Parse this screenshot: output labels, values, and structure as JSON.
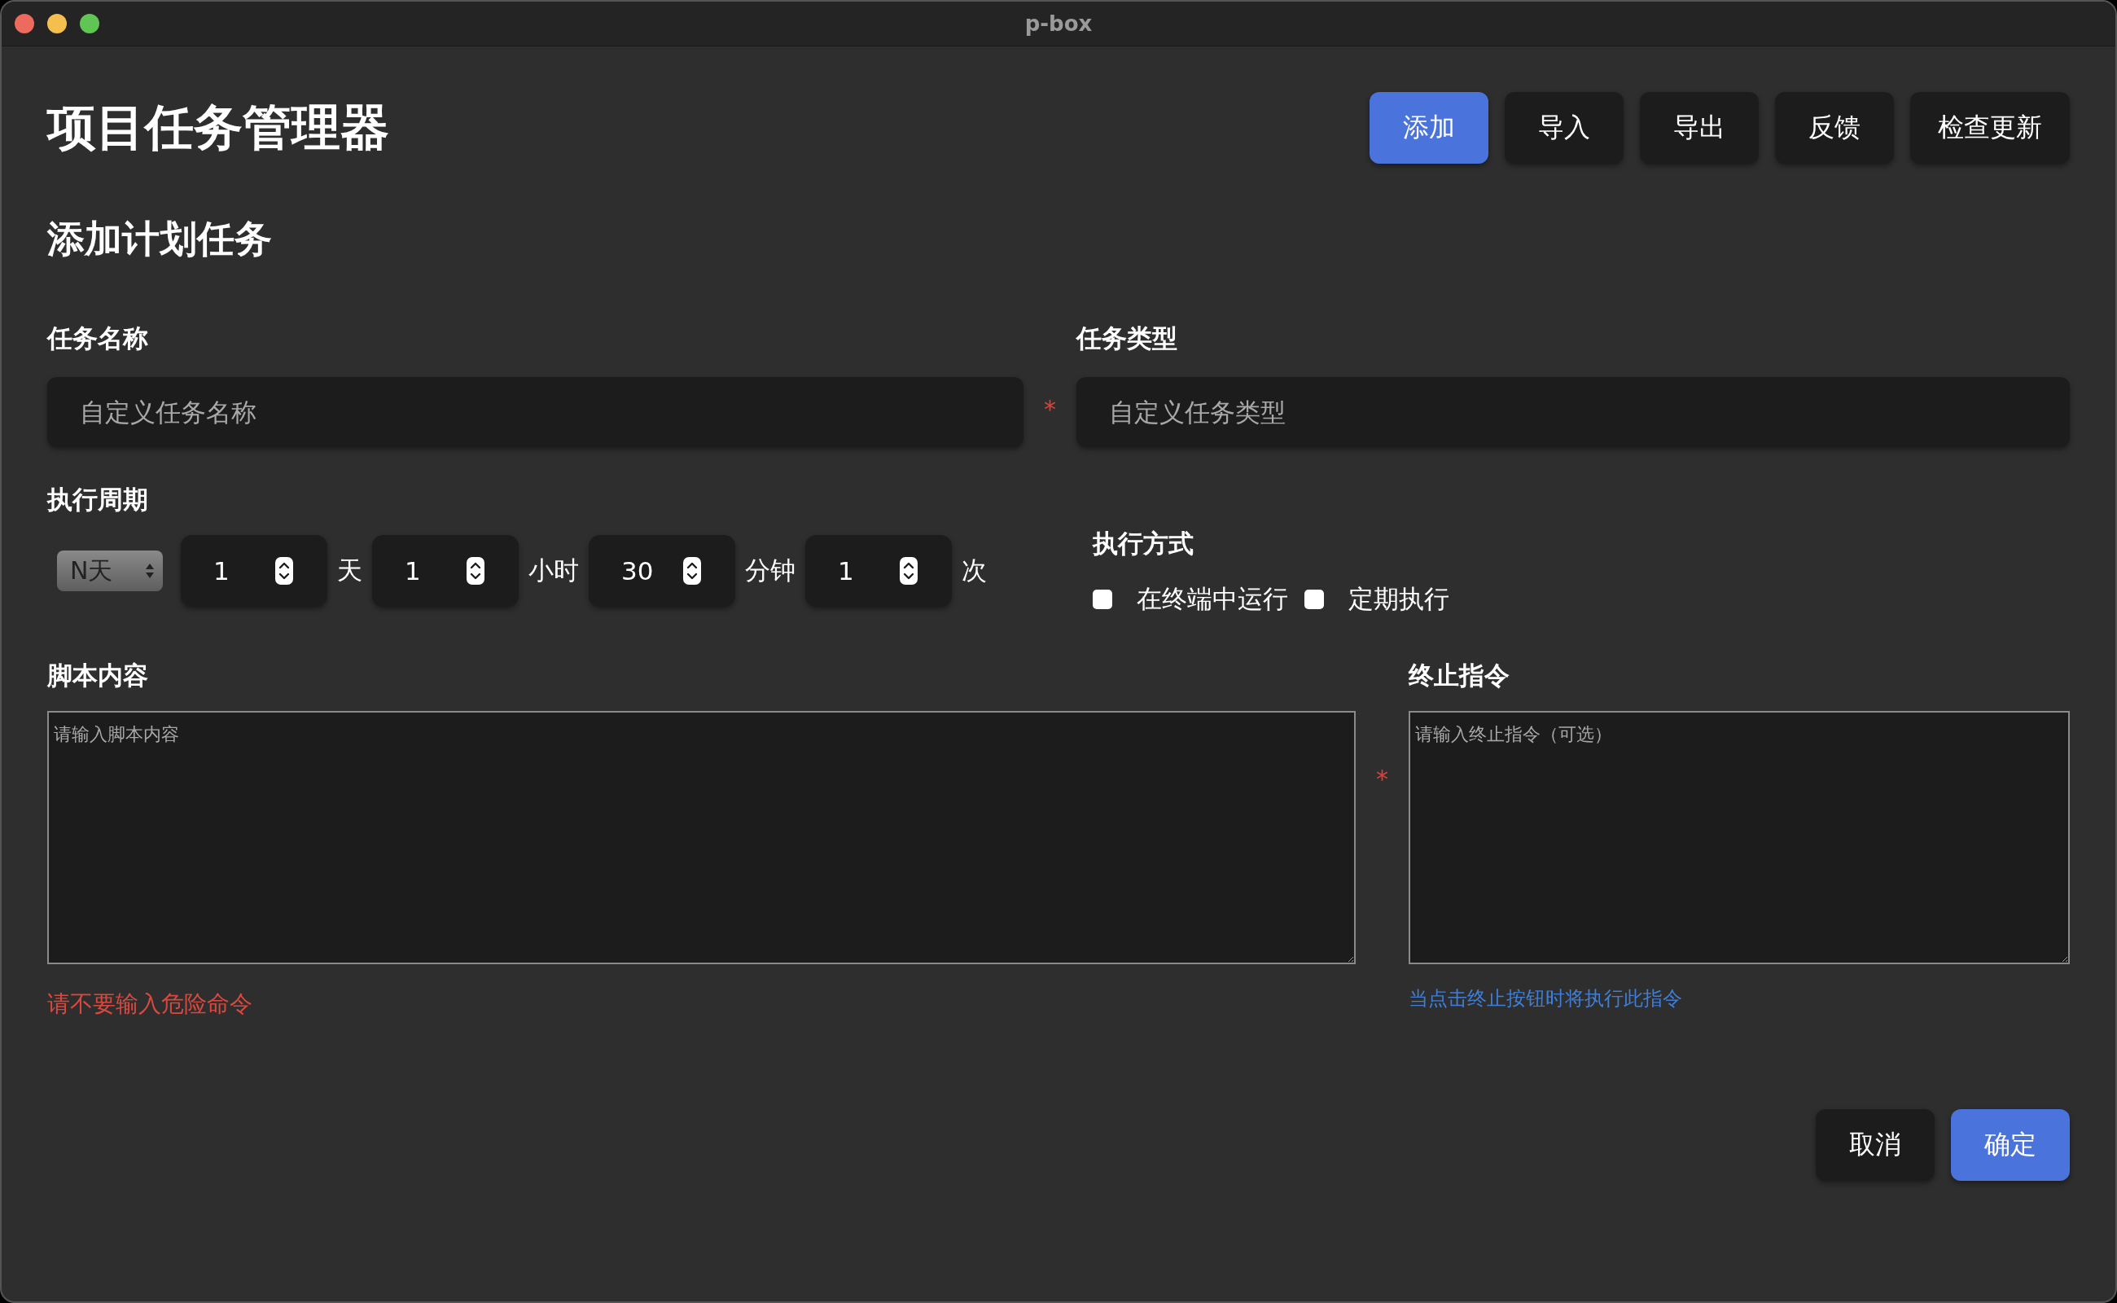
{
  "window": {
    "title": "p-box"
  },
  "app_title": "项目任务管理器",
  "toolbar": [
    {
      "label": "添加",
      "primary": true
    },
    {
      "label": "导入",
      "primary": false
    },
    {
      "label": "导出",
      "primary": false
    },
    {
      "label": "反馈",
      "primary": false
    },
    {
      "label": "检查更新",
      "primary": false
    }
  ],
  "section_title": "添加计划任务",
  "task_name": {
    "label": "任务名称",
    "placeholder": "自定义任务名称",
    "required_mark": "*"
  },
  "task_type": {
    "label": "任务类型",
    "placeholder": "自定义任务类型"
  },
  "period": {
    "label": "执行周期",
    "mode": "N天",
    "fields": [
      {
        "value": "1",
        "unit": "天"
      },
      {
        "value": "1",
        "unit": "小时"
      },
      {
        "value": "30",
        "unit": "分钟"
      },
      {
        "value": "1",
        "unit": "次"
      }
    ]
  },
  "execution": {
    "label": "执行方式",
    "options": [
      {
        "label": "在终端中运行",
        "checked": false
      },
      {
        "label": "定期执行",
        "checked": false
      }
    ]
  },
  "script": {
    "label": "脚本内容",
    "placeholder": "请输入脚本内容",
    "required_mark": "*",
    "note": "请不要输入危险命令"
  },
  "stop_command": {
    "label": "终止指令",
    "placeholder": "请输入终止指令（可选）",
    "note": "当点击终止按钮时将执行此指令"
  },
  "footer_buttons": [
    {
      "label": "取消",
      "primary": false
    },
    {
      "label": "确定",
      "primary": true
    }
  ]
}
